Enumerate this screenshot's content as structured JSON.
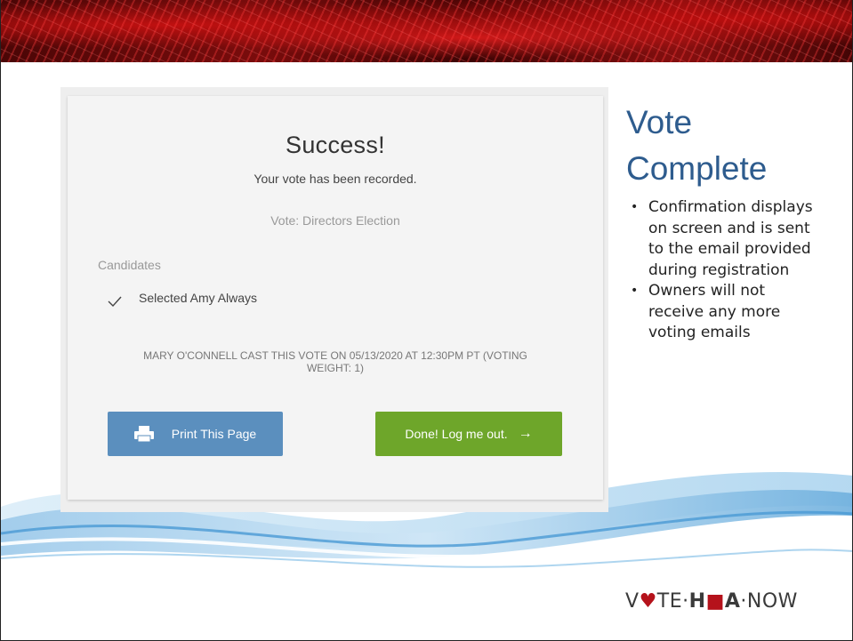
{
  "card": {
    "title": "Success!",
    "subtitle": "Your vote has been recorded.",
    "vote_name": "Vote: Directors Election",
    "candidates_label": "Candidates",
    "selection": "Selected Amy Always",
    "cast_note_line1": "MARY O'CONNELL CAST THIS VOTE ON 05/13/2020 AT 12:30PM PT (VOTING",
    "cast_note_line2": "WEIGHT: 1)",
    "print_button": "Print This Page",
    "done_button": "Done! Log me out.",
    "done_arrow": "→"
  },
  "side": {
    "title_line1": "Vote",
    "title_line2": "Complete",
    "bullets": [
      "Confirmation displays on screen and is sent to the email provided during registration",
      "Owners will not receive any more voting emails"
    ],
    "bullet_lines": [
      [
        "Confirmation displays",
        "on screen and is sent",
        "to the email provided",
        "during registration"
      ],
      [
        "Owners will not",
        "receive any more",
        "voting emails"
      ]
    ]
  },
  "logo": {
    "part1": "V",
    "heart": "♥",
    "part2": "TE·",
    "part3": "H",
    "house": "■",
    "part4": "A",
    "part5": "·NOW"
  },
  "colors": {
    "print_button": "#5b8fbe",
    "done_button": "#6ea62a",
    "title_blue": "#2e5c8e",
    "banner_red": "#7a0c0c"
  },
  "icons": {
    "check": "check-icon",
    "printer": "printer-icon",
    "arrow": "arrow-right-icon"
  }
}
